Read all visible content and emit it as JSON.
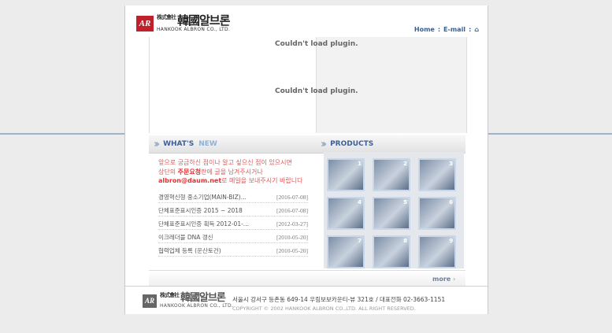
{
  "header": {
    "logo_mark": "AR",
    "logo_prefix": "株式會社",
    "logo_main": "韓國알브론",
    "logo_sub": "HANKOOK ALBRON CO., LTD.",
    "nav": [
      "Home",
      "E-mail"
    ],
    "nav_sep": ":"
  },
  "plugin": {
    "message_1": "Couldn't load plugin.",
    "message_2": "Couldn't load plugin."
  },
  "whats_new": {
    "title_1": "WHAT'S",
    "title_2": "NEW",
    "notice_line1": "앞으로 궁금하신 점이나 알고 싶으신 점이 있으시면",
    "notice_line2_pre": "상단의 ",
    "notice_line2_bold": "주문요청",
    "notice_line2_post": "란에 글을 남겨주시거나",
    "notice_line3_bold": "albron@daum.net",
    "notice_line3_post": "로 메일을 보내주시기 바랍니다",
    "items": [
      {
        "title": "경영혁신형 중소기업(MAIN-BIZ)...",
        "date": "[2016-07-08]"
      },
      {
        "title": "단체표준표시인증 2015 ~ 2018",
        "date": "[2016-07-08]"
      },
      {
        "title": "단체표준표시인증 획득 2012-01-...",
        "date": "[2012-03-27]"
      },
      {
        "title": "이크레더블 DNA 갱신",
        "date": "[2010-05-20]"
      },
      {
        "title": "협력업체 등록 (운산토건)",
        "date": "[2010-05-20]"
      }
    ]
  },
  "products": {
    "title": "PRODUCTS",
    "thumbs": [
      "1",
      "2",
      "3",
      "4",
      "5",
      "6",
      "7",
      "8",
      "9"
    ],
    "more_label": "more",
    "more_arrow": "›"
  },
  "footer": {
    "logo_mark": "AR",
    "logo_prefix": "株式會社",
    "logo_main": "韓國알브론",
    "logo_sub": "HANKOOK ALBRON CO., LTD.",
    "address": "서울시 강서구 등촌동 649-14 우림보보카운티-뷰 321호  /  대표전화 02-3663-1151",
    "copyright": "COPYRIGHT © 2002 HANKOOK ALBRON CO.,LTD. ALL RIGHT RESERVED."
  }
}
